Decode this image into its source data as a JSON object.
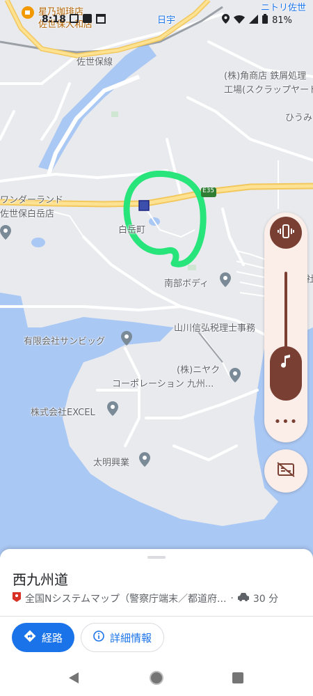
{
  "status_bar": {
    "time": "8:18",
    "battery": "81%"
  },
  "map": {
    "labels": {
      "cafe": "星乃珈琲店",
      "cafe2": "佐世保大和店",
      "sasebo_line": "佐世保線",
      "hiu": "日宇",
      "nitori": "ニトリ佐世",
      "kadoshoten": "(株)角商店 鉄屑処理",
      "kadoshoten2": "工場(スクラップヤード",
      "himi": "ひうみ",
      "wonderland": "ワンダーランド",
      "shirodake": "佐世保白岳店",
      "shirodake_town": "白岳町",
      "route_num": "E35",
      "nanbu": "南部ボディ",
      "yamakawa": "山川信弘税理士事務",
      "sanbig": "有限会社サンビッグ",
      "niyaku": "(株)ニヤク",
      "niyaku2": "コーポレーション 九州...",
      "excel": "株式会社EXCEL",
      "taimei": "太明興業",
      "right_edge": "社"
    }
  },
  "sound_panel": {
    "vibrate_icon": "vibrate-icon",
    "music_icon": "music-note-icon",
    "volume_level": 0.46,
    "more_label": "•••",
    "captions_icon": "captions-off-icon"
  },
  "sheet": {
    "title": "西九州道",
    "source": "全国Nシステムマップ（警察庁端末／都道府...",
    "separator": "·",
    "drive_time": "30 分",
    "route_label": "経路",
    "details_label": "詳細情報",
    "accent": "#1a73e8"
  }
}
